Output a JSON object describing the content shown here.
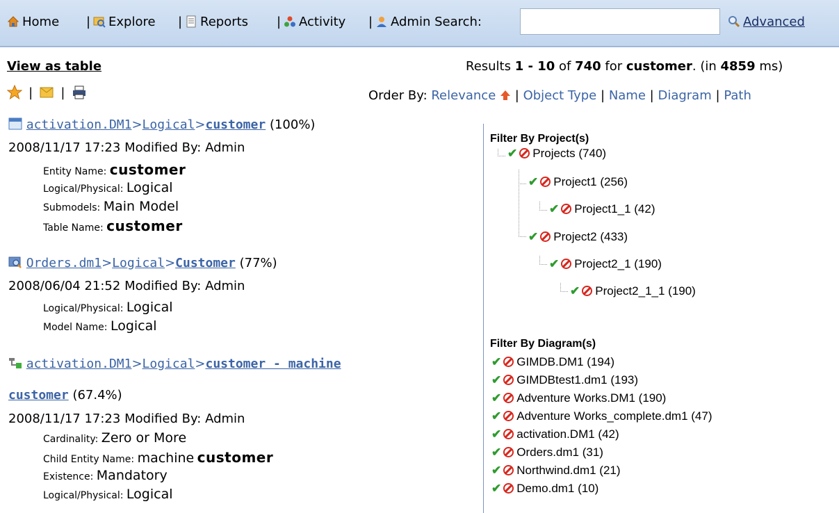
{
  "topbar": {
    "home": "Home",
    "explore": "Explore",
    "reports": "Reports",
    "activity": "Activity",
    "admin_search": "Admin Search:",
    "advanced": "Advanced",
    "search_value": ""
  },
  "results": {
    "view_as_table": "View as table",
    "summary_prefix": "Results ",
    "range": "1 - 10",
    "of": " of ",
    "total": "740",
    "for": " for ",
    "query": "customer",
    "in": ". (in ",
    "ms": "4859",
    "ms_suffix": " ms)"
  },
  "order_by": {
    "label": "Order By: ",
    "options": [
      "Relevance",
      "Object Type",
      "Name",
      "Diagram",
      "Path"
    ]
  },
  "items": [
    {
      "path": [
        "activation.DM1",
        "Logical"
      ],
      "name": "customer",
      "score": "(100%)",
      "modified": "2008/11/17 17:23 Modified By: Admin",
      "attrs": [
        {
          "k": "Entity Name: ",
          "v": "customer",
          "bold": true
        },
        {
          "k": "Logical/Physical: ",
          "v": "Logical"
        },
        {
          "k": "Submodels: ",
          "v": "Main Model"
        },
        {
          "k": "Table Name: ",
          "v": "customer",
          "bold": true
        }
      ]
    },
    {
      "path": [
        "Orders.dm1",
        "Logical"
      ],
      "name": "Customer",
      "score": "(77%)",
      "modified": "2008/06/04 21:52 Modified By: Admin",
      "attrs": [
        {
          "k": "Logical/Physical: ",
          "v": "Logical"
        },
        {
          "k": "Model Name: ",
          "v": "Logical"
        }
      ]
    },
    {
      "path": [
        "activation.DM1",
        "Logical"
      ],
      "name": "customer - machine",
      "name2": "customer",
      "score": "(67.4%)",
      "modified": "2008/11/17 17:23 Modified By: Admin",
      "attrs": [
        {
          "k": "Cardinality: ",
          "v": "Zero or More"
        },
        {
          "k": "Child Entity Name: ",
          "v": "machine",
          "v2": "customer"
        },
        {
          "k": "Existence: ",
          "v": "Mandatory"
        },
        {
          "k": "Logical/Physical: ",
          "v": "Logical"
        }
      ]
    }
  ],
  "filter_projects": {
    "title": "Filter By Project(s)",
    "items": [
      "Projects (740)",
      "Project1 (256)",
      "Project1_1 (42)",
      "Project2 (433)",
      "Project2_1 (190)",
      "Project2_1_1 (190)"
    ]
  },
  "filter_diagrams": {
    "title": "Filter By Diagram(s)",
    "items": [
      "GIMDB.DM1 (194)",
      "GIMDBtest1.dm1 (193)",
      "Adventure Works.DM1 (190)",
      "Adventure Works_complete.dm1 (47)",
      "activation.DM1 (42)",
      "Orders.dm1 (31)",
      "Northwind.dm1 (21)",
      "Demo.dm1 (10)"
    ]
  },
  "colors": {
    "link": "#3b64a6",
    "check": "#2f9b2f",
    "exclude": "#d7261d",
    "toolbar": "#c9dbf0"
  }
}
